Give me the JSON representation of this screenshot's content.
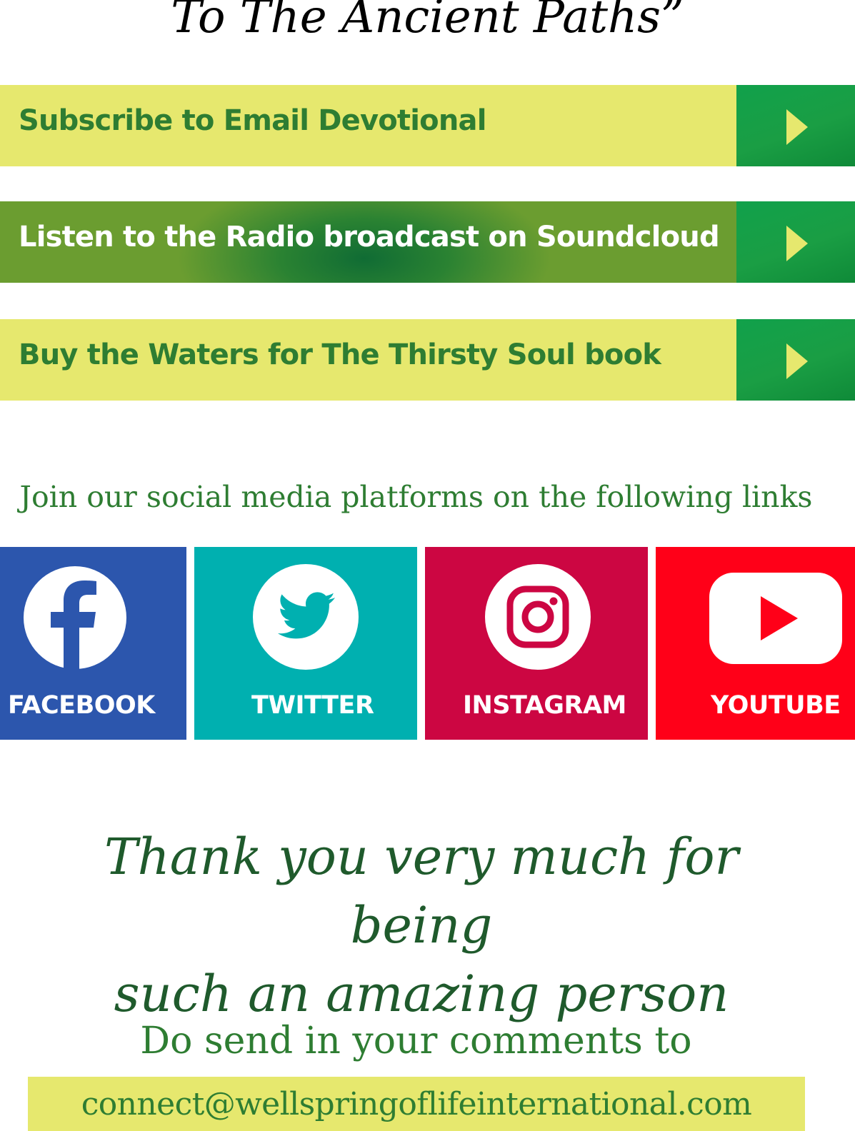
{
  "header": {
    "title": "To The Ancient Paths”"
  },
  "cta_buttons": [
    {
      "label": "Subscribe to Email Devotional",
      "style": "yellow"
    },
    {
      "label": "Listen to the Radio broadcast on Soundcloud",
      "style": "green"
    },
    {
      "label": "Buy the Waters for The Thirsty Soul book",
      "style": "yellow"
    }
  ],
  "social": {
    "heading": "Join our social media platforms on the following links",
    "platforms": [
      {
        "label": "FACEBOOK",
        "icon": "facebook-icon",
        "color": "#2c56ad"
      },
      {
        "label": "TWITTER",
        "icon": "twitter-icon",
        "color": "#00b0b0"
      },
      {
        "label": "INSTAGRAM",
        "icon": "instagram-icon",
        "color": "#cc0642"
      },
      {
        "label": "YOUTUBE",
        "icon": "youtube-icon",
        "color": "#ff0018"
      }
    ]
  },
  "thanks": {
    "line1": "Thank you very much for being",
    "line2": "such an amazing person"
  },
  "contact": {
    "label": "Do send in your comments to",
    "email": "connect@wellspringoflifeinternational.com"
  },
  "colors": {
    "brand_green": "#2e7d32",
    "cta_yellow": "#e6e86e",
    "arrow_green": "#12a048",
    "dark_green_text": "#1f5a2c"
  }
}
